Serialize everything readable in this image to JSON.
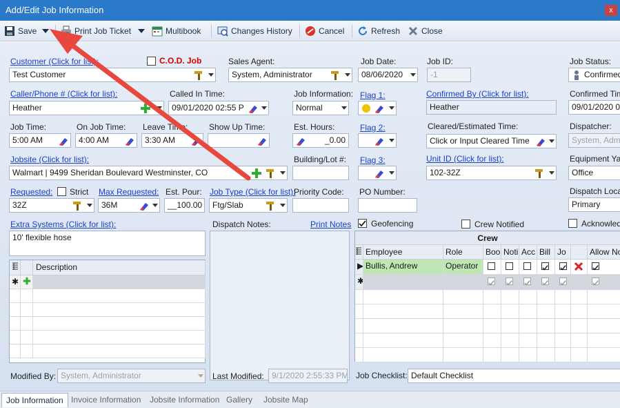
{
  "window": {
    "title": "Add/Edit Job Information",
    "close_glyph": "x"
  },
  "toolbar": {
    "save": "Save",
    "print_job_ticket": "Print Job Ticket",
    "multibook": "Multibook",
    "changes_history": "Changes History",
    "cancel": "Cancel",
    "refresh": "Refresh",
    "close": "Close"
  },
  "form": {
    "customer_label": "Customer (Click for list):",
    "customer_value": "Test Customer",
    "cod_label": "C.O.D. Job",
    "sales_agent_label": "Sales Agent:",
    "sales_agent_value": "System, Administrator",
    "job_date_label": "Job Date:",
    "job_date_value": "08/06/2020",
    "job_id_label": "Job ID:",
    "job_id_value": "-1",
    "job_status_label": "Job Status:",
    "job_status_value": "Confirmed",
    "caller_label": "Caller/Phone # (Click for list):",
    "caller_value": "Heather",
    "called_in_label": "Called In Time:",
    "called_in_value": "09/01/2020 02:55 P",
    "job_info_label": "Job Information:",
    "job_info_value": "Normal",
    "flag1_label": "Flag 1:",
    "confirmed_by_label": "Confirmed By (Click for list):",
    "confirmed_by_value": "Heather",
    "confirmed_time_label": "Confirmed Tim",
    "confirmed_time_value": "09/01/2020 0",
    "job_time_label": "Job Time:",
    "job_time_value": "5:00 AM",
    "on_job_label": "On Job Time:",
    "on_job_value": "4:00 AM",
    "leave_label": "Leave Time:",
    "leave_value": "3:30 AM",
    "show_up_label": "Show Up Time:",
    "show_up_value": "",
    "est_hours_label": "Est. Hours:",
    "est_hours_value": "_0.00",
    "flag2_label": "Flag 2:",
    "cleared_label": "Cleared/Estimated Time:",
    "cleared_value": "Click or Input Cleared Time",
    "dispatcher_label": "Dispatcher:",
    "dispatcher_value": "System, Admi",
    "jobsite_label": "Jobsite (Click for list):",
    "jobsite_value": "Walmart | 9499 Sheridan Boulevard Westminster, CO",
    "building_label": "Building/Lot #:",
    "building_value": "",
    "flag3_label": "Flag 3:",
    "unit_label": "Unit ID (Click for list):",
    "unit_value": "102-32Z",
    "equipment_label": "Equipment Yar",
    "equipment_value": "Office",
    "requested_label": "Requested:",
    "strict_label": "Strict",
    "requested_value": "32Z",
    "max_req_label": "Max Requested:",
    "max_req_value": "36M",
    "est_pour_label": "Est. Pour:",
    "est_pour_value": "__100.00",
    "job_type_label": "Job Type (Click for list):",
    "job_type_value": "Ftg/Slab",
    "priority_label": "Priority Code:",
    "priority_value": "",
    "po_label": "PO Number:",
    "po_value": "",
    "dispatch_loc_label": "Dispatch Loca",
    "dispatch_loc_value": "Primary",
    "extra_systems_label": "Extra Systems (Click for list):",
    "extra_systems_value": "10' flexible hose",
    "dispatch_notes_label": "Dispatch Notes:",
    "print_notes_label": "Print Notes",
    "geofencing_label": "Geofencing",
    "crew_notified_label": "Crew Notified",
    "acknowledged_label": "Acknowled",
    "description_header": "Description",
    "modified_by_label": "Modified By:",
    "modified_by_value": "System, Administrator",
    "last_modified_label": "Last Modified:",
    "last_modified_value": "9/1/2020 2:55:33 PM",
    "job_checklist_label": "Job Checklist:",
    "job_checklist_value": "Default Checklist"
  },
  "crew": {
    "title": "Crew",
    "headers": [
      "Employee",
      "Role",
      "Boo",
      "Noti",
      "Acc",
      "Bill",
      "Jo",
      "",
      "Allow No"
    ],
    "rows": [
      {
        "employee": "Bullis, Andrew",
        "role": "Operator"
      }
    ]
  },
  "tabs": [
    "Job Information",
    "Invoice Information",
    "Jobsite Information",
    "Gallery",
    "Jobsite Map"
  ],
  "colors": {
    "accent": "#2b79c9",
    "cod": "#d40000",
    "link": "#1b3fd0",
    "arrow": "#e8473d"
  }
}
